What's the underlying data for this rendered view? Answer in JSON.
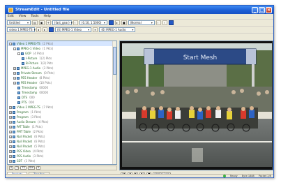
{
  "window": {
    "title": "StreamEdit - Untitled file"
  },
  "menu": [
    "Edit",
    "View",
    "Tools",
    "Help"
  ],
  "toolbar1": {
    "combo1": "Untitled",
    "combo2": "(fast_gear)",
    "combo3": "(0.10,  1.5000)",
    "combo4": "(Normal"
  },
  "toolbar2": {
    "combo1": "video 1 MPEG-TS",
    "combo2": "(6) MPEG-1 Video",
    "combo3": "(6) MPEG-1 Audio"
  },
  "tree": [
    {
      "level": 0,
      "exp": "−",
      "label": "Video 1 MPEG-TS",
      "meta": "(2 Pkts)",
      "sel": true
    },
    {
      "level": 1,
      "exp": "−",
      "label": "MPEG-1 Video",
      "meta": "(1 Pkts)"
    },
    {
      "level": 2,
      "exp": "−",
      "label": "GOP",
      "meta": "(4 Pkts)"
    },
    {
      "level": 3,
      "exp": "",
      "label": "I-Picture",
      "meta": "1(2) Pkts"
    },
    {
      "level": 3,
      "exp": "",
      "label": "B-Picture",
      "meta": "1(2) Pkts"
    },
    {
      "level": 1,
      "exp": "+",
      "label": "MPEG-1 Audio",
      "meta": "(3 Pkts)"
    },
    {
      "level": 1,
      "exp": "+",
      "label": "Private Stream",
      "meta": "(0 Pkts)"
    },
    {
      "level": 1,
      "exp": "+",
      "label": "PES Header",
      "meta": "(8 Pkts)"
    },
    {
      "level": 1,
      "exp": "+",
      "label": "PES Header",
      "meta": "(10 Pkts)"
    },
    {
      "level": 2,
      "exp": "",
      "label": "Timestamp",
      "meta": "00000"
    },
    {
      "level": 2,
      "exp": "",
      "label": "Timestamp",
      "meta": "00000"
    },
    {
      "level": 2,
      "exp": "",
      "label": "DTS",
      "meta": "000"
    },
    {
      "level": 2,
      "exp": "",
      "label": "PTS",
      "meta": "000"
    },
    {
      "level": 0,
      "exp": "+",
      "label": "Video 2 MPEG-TS",
      "meta": "(7 Pkts)"
    },
    {
      "level": 0,
      "exp": "+",
      "label": "Program",
      "meta": "(1 Pkts)"
    },
    {
      "level": 0,
      "exp": "+",
      "label": "Program",
      "meta": "(3 Pkts)"
    },
    {
      "level": 0,
      "exp": "+",
      "label": "Audio Stream",
      "meta": "(4 Pkts)"
    },
    {
      "level": 0,
      "exp": "+",
      "label": "PAT Table",
      "meta": "(1 Pkts)"
    },
    {
      "level": 0,
      "exp": "+",
      "label": "PMT Table",
      "meta": "(2 Pkts)"
    },
    {
      "level": 0,
      "exp": "+",
      "label": "Null Packet",
      "meta": "(6 Pkts)"
    },
    {
      "level": 0,
      "exp": "+",
      "label": "Null Packet",
      "meta": "(6 Pkts)"
    },
    {
      "level": 0,
      "exp": "+",
      "label": "Null Packet",
      "meta": "(5 Pkts)"
    },
    {
      "level": 0,
      "exp": "+",
      "label": "PES Video",
      "meta": "(4 Pkts)"
    },
    {
      "level": 0,
      "exp": "+",
      "label": "PES Audio",
      "meta": "(3 Pkts)"
    },
    {
      "level": 0,
      "exp": "+",
      "label": "SDT",
      "meta": "(1 Pkts)"
    },
    {
      "level": 0,
      "exp": "+",
      "label": "EIT",
      "meta": "(2 Pkts)"
    }
  ],
  "tree_bar": [
    "0",
    "1",
    "TS",
    "IDX",
    "0"
  ],
  "tabs": [
    "Packets",
    "Tree/Ins"
  ],
  "video": {
    "banner": "Start Mesh"
  },
  "video_ctrl": [
    "|◀",
    "◀",
    "▶",
    "▶|",
    "■",
    "00:00:12:04"
  ],
  "status": [
    "Ready",
    "Byte 1888",
    "Packet 2/6"
  ],
  "colors": {
    "titlebar": "#1c5fd6",
    "tree_text": "#2a6a2a",
    "banner": "#2c4a86"
  }
}
